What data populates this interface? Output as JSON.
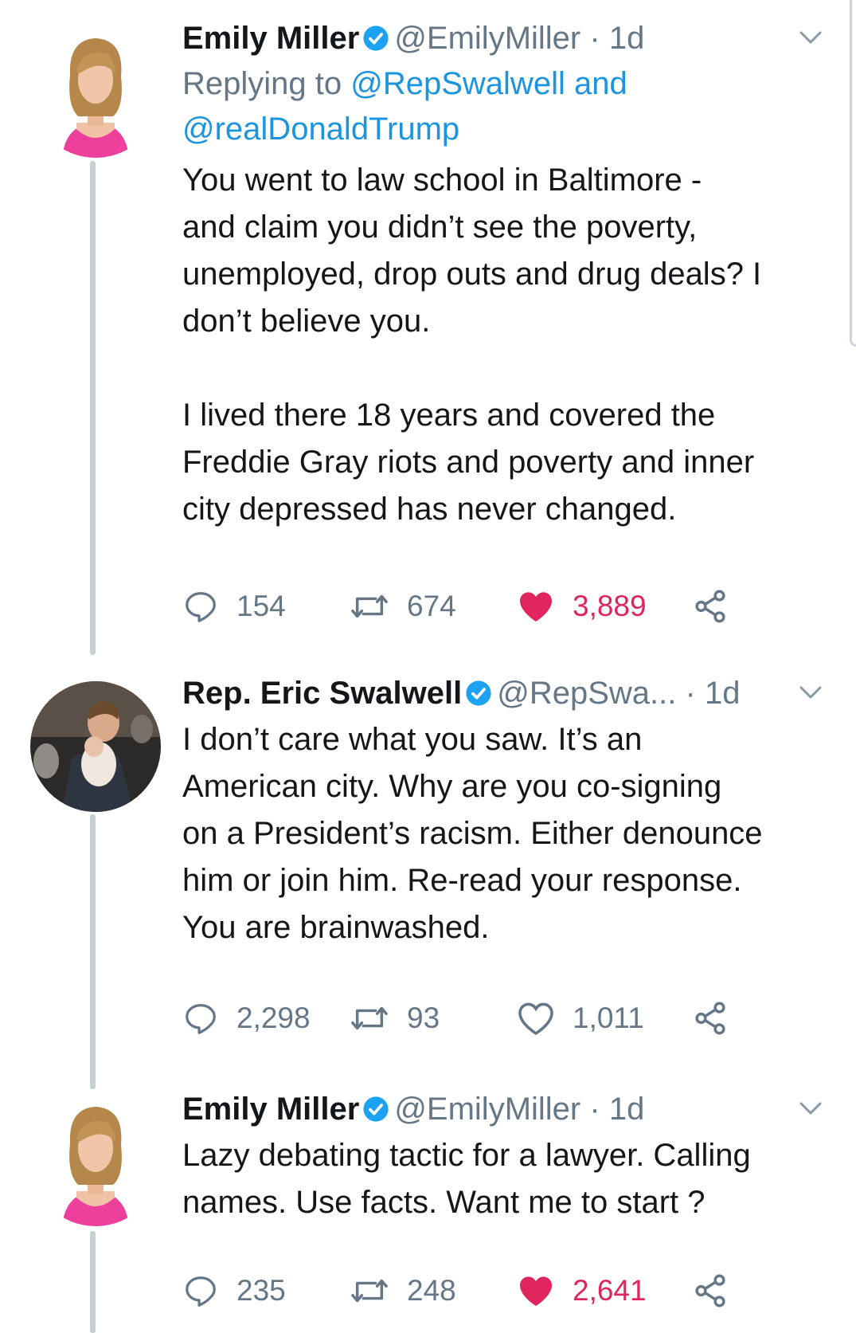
{
  "tweets": [
    {
      "author_name": "Emily Miller",
      "handle": "@EmilyMiller",
      "separator": "·",
      "time": "1d",
      "replying_prefix": "Replying to",
      "replying_mention_1": "@RepSwalwell",
      "replying_joiner": "and",
      "replying_mention_2": "@realDonaldTrump",
      "text": "You went to law school in Baltimore -\nand claim you didn’t see the poverty,\nunemployed, drop outs and drug deals? I\ndon’t believe you.\n\nI lived there 18 years and covered the\nFreddie Gray riots and poverty and inner\ncity depressed has never changed.",
      "replies": "154",
      "retweets": "674",
      "likes": "3,889",
      "liked": true,
      "verified": true
    },
    {
      "author_name": "Rep. Eric Swalwell",
      "handle": "@RepSwa...",
      "separator": "·",
      "time": "1d",
      "text": "I don’t care what you saw. It’s an\nAmerican city. Why are you co-signing\non a President’s racism. Either denounce\nhim or join him. Re-read your response.\nYou are brainwashed.",
      "replies": "2,298",
      "retweets": "93",
      "likes": "1,011",
      "liked": false,
      "verified": true
    },
    {
      "author_name": "Emily Miller",
      "handle": "@EmilyMiller",
      "separator": "·",
      "time": "1d",
      "text": "Lazy debating tactic for a lawyer. Calling\nnames. Use facts. Want me to start ?",
      "replies": "235",
      "retweets": "248",
      "likes": "2,641",
      "liked": true,
      "verified": true
    }
  ],
  "icons": {
    "verified": "verified-badge-icon",
    "caret": "chevron-down-icon",
    "reply": "reply-bubble-icon",
    "retweet": "retweet-arrows-icon",
    "like": "heart-icon",
    "share": "share-icon"
  },
  "colors": {
    "text": "#14171a",
    "secondary": "#657786",
    "link": "#1b95e0",
    "like": "#e0245e",
    "thread_line": "#c4cfd6"
  }
}
